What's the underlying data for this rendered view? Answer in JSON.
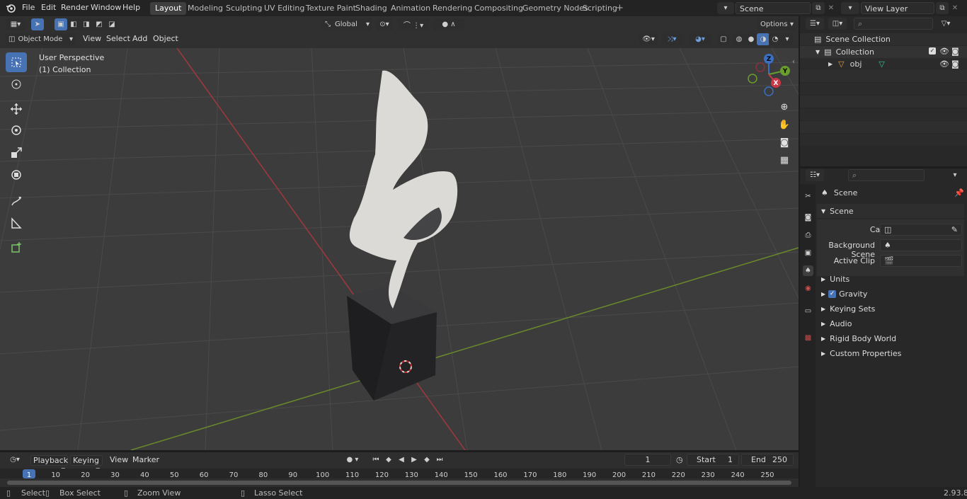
{
  "menus": [
    "File",
    "Edit",
    "Render",
    "Window",
    "Help"
  ],
  "workspaces": [
    "Layout",
    "Modeling",
    "Sculpting",
    "UV Editing",
    "Texture Paint",
    "Shading",
    "Animation",
    "Rendering",
    "Compositing",
    "Geometry Nodes",
    "Scripting"
  ],
  "scene_name": "Scene",
  "view_layer": "View Layer",
  "header": {
    "mode": "Object Mode",
    "view": "View",
    "select": "Select",
    "add": "Add",
    "object": "Object",
    "transform": "Global",
    "options": "Options"
  },
  "viewport": {
    "perspective": "User Perspective",
    "collection": "(1) Collection"
  },
  "gizmo": {
    "z": "Z",
    "y": "Y",
    "x": "X"
  },
  "outliner": {
    "scene_collection": "Scene Collection",
    "collection": "Collection",
    "obj": "obj"
  },
  "properties": {
    "tab_title": "Scene",
    "section": "Scene",
    "camera_label": "Camera",
    "background_label": "Background Scene",
    "clip_label": "Active Clip",
    "panels": [
      "Units",
      "Gravity",
      "Keying Sets",
      "Audio",
      "Rigid Body World",
      "Custom Properties"
    ],
    "gravity_checked": true
  },
  "timeline": {
    "playback": "Playback",
    "keying": "Keying",
    "view": "View",
    "marker": "Marker",
    "current_frame": "1",
    "start_label": "Start",
    "start": "1",
    "end_label": "End",
    "end": "250",
    "ticks": [
      "1",
      "10",
      "20",
      "30",
      "40",
      "50",
      "60",
      "70",
      "80",
      "90",
      "100",
      "110",
      "120",
      "130",
      "140",
      "150",
      "160",
      "170",
      "180",
      "190",
      "200",
      "210",
      "220",
      "230",
      "240",
      "250"
    ]
  },
  "status": {
    "select": "Select",
    "box_select": "Box Select",
    "zoom_view": "Zoom View",
    "lasso_select": "Lasso Select",
    "version": "2.93.8"
  }
}
